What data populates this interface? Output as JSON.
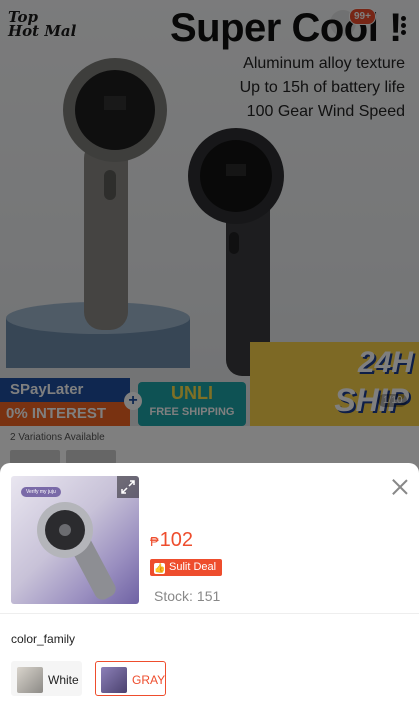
{
  "hero": {
    "shop_logo_line1": "Top",
    "shop_logo_line2": "Hot Mal",
    "title": "Super Cool !",
    "features": [
      "Aluminum alloy texture",
      "Up to 15h of battery life",
      "100 Gear Wind Speed"
    ],
    "cart_badge": "99+",
    "promo": {
      "spaylater": "SPayLater",
      "interest": "0% INTEREST",
      "plus": "+",
      "unli": "UNLI",
      "free_shipping": "FREE SHIPPING",
      "ship_24h": "24H",
      "ship_label": "SHIP"
    },
    "pager": "1/10"
  },
  "variations_text": "2 Variations Available",
  "sheet": {
    "thumb_tag": "Verify my juju",
    "price_currency": "₱",
    "price_value": "102",
    "deal_icon": "👍",
    "deal_label": "Sulit Deal",
    "stock_label": "Stock:",
    "stock_value": "151",
    "option_group_label": "color_family",
    "options": [
      {
        "label": "White",
        "selected": false
      },
      {
        "label": "GRAY",
        "selected": true
      }
    ]
  },
  "colors": {
    "accent": "#ee4d2d",
    "overlay": "rgba(0,0,0,0.5)"
  }
}
